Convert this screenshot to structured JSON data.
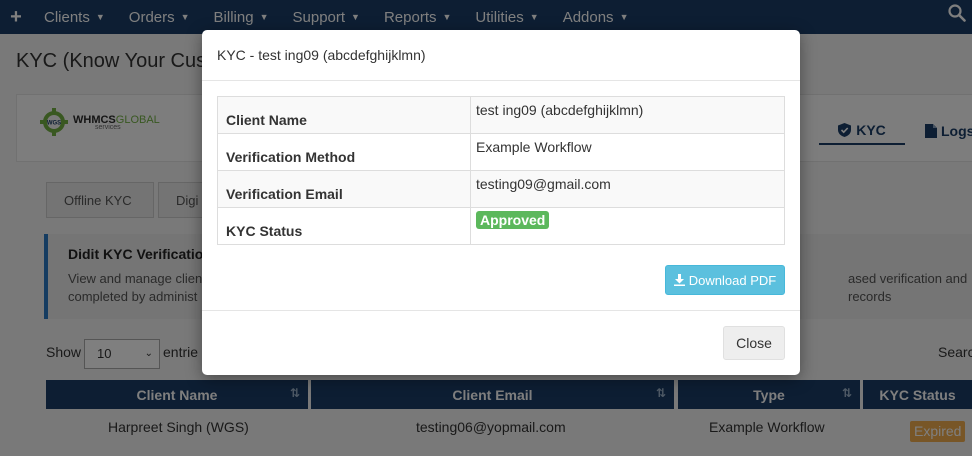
{
  "nav": {
    "items": [
      {
        "label": "Clients"
      },
      {
        "label": "Orders"
      },
      {
        "label": "Billing"
      },
      {
        "label": "Support"
      },
      {
        "label": "Reports"
      },
      {
        "label": "Utilities"
      },
      {
        "label": "Addons"
      }
    ]
  },
  "page": {
    "title": "KYC (Know Your Cust",
    "logo_main": "WHMCS",
    "logo_accent": "GLOBAL",
    "logo_sub": "services",
    "logo_badge": "WGS",
    "module_tabs": {
      "kyc": "KYC",
      "logs": "Logs"
    },
    "sub_tabs": [
      "Offline KYC",
      "Digi"
    ],
    "info_title": "Didit KYC Verification",
    "info_desc_line1": "View and manage clien",
    "info_desc_line1_right": "ased verification and records",
    "info_desc_line2": "completed by administ",
    "show_label": "Show",
    "entries_value": "10",
    "entries_label": "entrie",
    "search_label": "Searc"
  },
  "table": {
    "headers": [
      "Client Name",
      "Client Email",
      "Type",
      "KYC Status"
    ],
    "rows": [
      {
        "name": "Harpreet Singh (WGS)",
        "email": "testing06@yopmail.com",
        "type": "Example Workflow",
        "status": "Expired"
      }
    ]
  },
  "modal": {
    "title": "KYC - test ing09 (abcdefghijklmn)",
    "fields": [
      {
        "label": "Client Name",
        "value": "test ing09 (abcdefghijklmn)"
      },
      {
        "label": "Verification Method",
        "value": "Example Workflow"
      },
      {
        "label": "Verification Email",
        "value": "testing09@gmail.com"
      },
      {
        "label": "KYC Status",
        "value": "Approved"
      }
    ],
    "download_label": "Download PDF",
    "close_label": "Close"
  },
  "colors": {
    "nav": "#1a3d66",
    "approved": "#5cb85c",
    "expired": "#f0ad4e",
    "download": "#5bc0de"
  }
}
